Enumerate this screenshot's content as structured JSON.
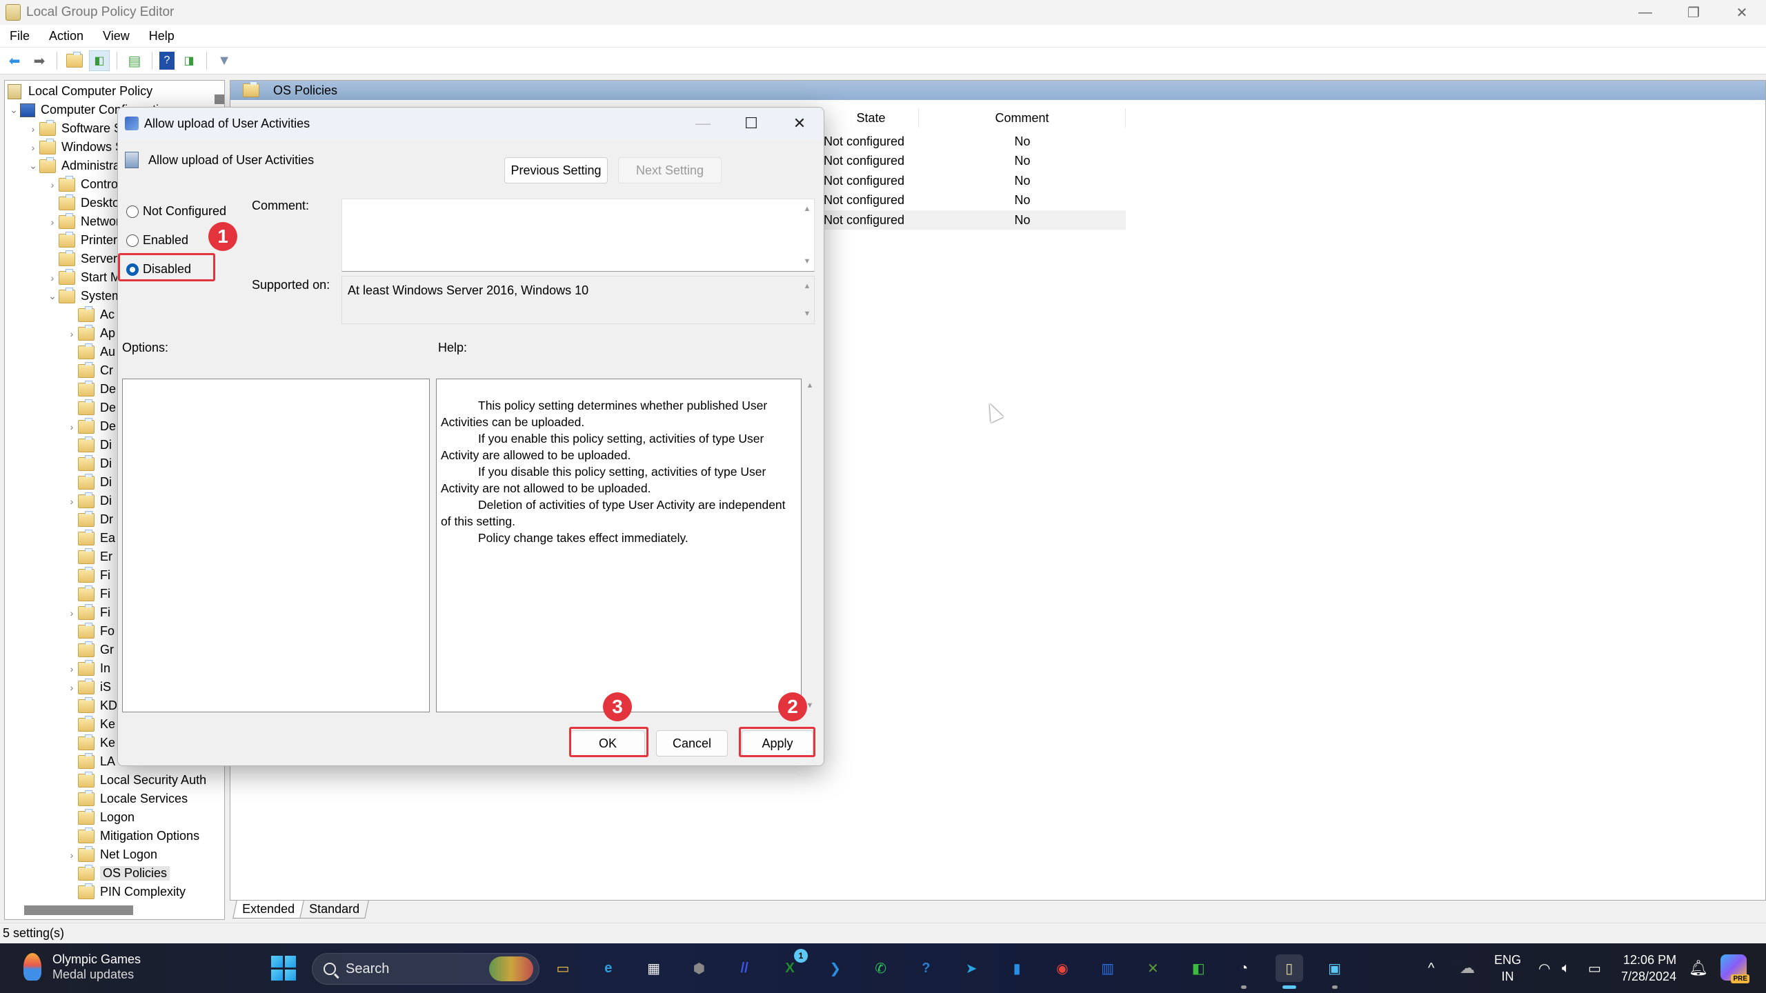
{
  "window": {
    "title": "Local Group Policy Editor",
    "controls": {
      "minimize": "—",
      "restore": "❐",
      "close": "✕"
    }
  },
  "menu": [
    "File",
    "Action",
    "View",
    "Help"
  ],
  "toolbar": {
    "icons": [
      "back-icon",
      "forward-icon",
      "up-folder-icon",
      "show-hide-tree-icon",
      "export-list-icon",
      "help-icon",
      "show-hide-action-pane-icon",
      "filter-icon"
    ]
  },
  "tree": {
    "root": "Local Computer Policy",
    "computer_config": "Computer Configuration",
    "items": [
      {
        "label": "Software Settings",
        "level": 2,
        "chevron": "›"
      },
      {
        "label": "Windows Settings",
        "level": 2,
        "chevron": "›"
      },
      {
        "label": "Administrative Templates",
        "level": 2,
        "chevron": "⌄"
      },
      {
        "label": "Control Panel",
        "level": 3,
        "chevron": "›"
      },
      {
        "label": "Desktop",
        "level": 3,
        "chevron": ""
      },
      {
        "label": "Network",
        "level": 3,
        "chevron": "›"
      },
      {
        "label": "Printers",
        "level": 3,
        "chevron": ""
      },
      {
        "label": "Server",
        "level": 3,
        "chevron": ""
      },
      {
        "label": "Start Menu and Taskbar",
        "level": 3,
        "chevron": "›"
      },
      {
        "label": "System",
        "level": 3,
        "chevron": "⌄"
      },
      {
        "label": "Ac",
        "level": 4,
        "chevron": ""
      },
      {
        "label": "Ap",
        "level": 4,
        "chevron": "›"
      },
      {
        "label": "Au",
        "level": 4,
        "chevron": ""
      },
      {
        "label": "Cr",
        "level": 4,
        "chevron": ""
      },
      {
        "label": "De",
        "level": 4,
        "chevron": ""
      },
      {
        "label": "De",
        "level": 4,
        "chevron": ""
      },
      {
        "label": "De",
        "level": 4,
        "chevron": "›"
      },
      {
        "label": "Di",
        "level": 4,
        "chevron": ""
      },
      {
        "label": "Di",
        "level": 4,
        "chevron": ""
      },
      {
        "label": "Di",
        "level": 4,
        "chevron": ""
      },
      {
        "label": "Di",
        "level": 4,
        "chevron": "›"
      },
      {
        "label": "Dr",
        "level": 4,
        "chevron": ""
      },
      {
        "label": "Ea",
        "level": 4,
        "chevron": ""
      },
      {
        "label": "Er",
        "level": 4,
        "chevron": ""
      },
      {
        "label": "Fi",
        "level": 4,
        "chevron": ""
      },
      {
        "label": "Fi",
        "level": 4,
        "chevron": ""
      },
      {
        "label": "Fi",
        "level": 4,
        "chevron": "›"
      },
      {
        "label": "Fo",
        "level": 4,
        "chevron": ""
      },
      {
        "label": "Gr",
        "level": 4,
        "chevron": ""
      },
      {
        "label": "In",
        "level": 4,
        "chevron": "›"
      },
      {
        "label": "iS",
        "level": 4,
        "chevron": "›"
      },
      {
        "label": "KD",
        "level": 4,
        "chevron": ""
      },
      {
        "label": "Ke",
        "level": 4,
        "chevron": ""
      },
      {
        "label": "Ke",
        "level": 4,
        "chevron": ""
      },
      {
        "label": "LA",
        "level": 4,
        "chevron": ""
      },
      {
        "label": "Local Security Auth",
        "level": 4,
        "chevron": ""
      },
      {
        "label": "Locale Services",
        "level": 4,
        "chevron": ""
      },
      {
        "label": "Logon",
        "level": 4,
        "chevron": ""
      },
      {
        "label": "Mitigation Options",
        "level": 4,
        "chevron": ""
      },
      {
        "label": "Net Logon",
        "level": 4,
        "chevron": "›"
      },
      {
        "label": "OS Policies",
        "level": 4,
        "chevron": "",
        "selected": true
      },
      {
        "label": "PIN Complexity",
        "level": 4,
        "chevron": ""
      }
    ]
  },
  "right_pane": {
    "folder": "OS Policies",
    "columns": {
      "state": "State",
      "comment": "Comment"
    },
    "rows": [
      {
        "state": "Not configured",
        "comment": "No"
      },
      {
        "state": "Not configured",
        "comment": "No"
      },
      {
        "state": "Not configured",
        "comment": "No"
      },
      {
        "state": "Not configured",
        "comment": "No"
      },
      {
        "state": "Not configured",
        "comment": "No"
      }
    ],
    "tabs": [
      "Extended",
      "Standard"
    ]
  },
  "status": "5 setting(s)",
  "dialog": {
    "title": "Allow upload of User Activities",
    "setting_name": "Allow upload of User Activities",
    "prev_button": "Previous Setting",
    "next_button": "Next Setting",
    "radios": [
      {
        "label": "Not Configured",
        "checked": false
      },
      {
        "label": "Enabled",
        "checked": false
      },
      {
        "label": "Disabled",
        "checked": true
      }
    ],
    "comment_label": "Comment:",
    "comment_value": "",
    "supported_label": "Supported on:",
    "supported_value": "At least Windows Server 2016, Windows 10",
    "options_label": "Options:",
    "help_label": "Help:",
    "help_paragraphs": [
      "This policy setting determines whether published User Activities can be uploaded.",
      "If you enable this policy setting, activities of type User Activity are allowed to be uploaded.",
      "If you disable this policy setting, activities of type User Activity are not allowed to be uploaded.",
      "Deletion of activities of type User Activity are independent of this setting.",
      "Policy change takes effect immediately."
    ],
    "ok": "OK",
    "cancel": "Cancel",
    "apply": "Apply"
  },
  "annotations": {
    "color": "#e3343d",
    "badges": [
      "1",
      "2",
      "3"
    ]
  },
  "taskbar": {
    "widget_title": "Olympic Games",
    "widget_sub": "Medal updates",
    "search_placeholder": "Search",
    "apps": [
      {
        "name": "file-explorer-icon",
        "glyph": "▭",
        "color": "#f5c542"
      },
      {
        "name": "edge-icon",
        "glyph": "e",
        "color": "#2ea0e0"
      },
      {
        "name": "ms-store-icon",
        "glyph": "▦",
        "color": "#f0f0f0"
      },
      {
        "name": "app-hex-icon",
        "glyph": "⬢",
        "color": "#888"
      },
      {
        "name": "app-blue-icon",
        "glyph": "//",
        "color": "#3d56e8"
      },
      {
        "name": "xbox-icon",
        "glyph": "X",
        "color": "#1f8f2a",
        "badge": "1"
      },
      {
        "name": "vscode-icon",
        "glyph": "❯",
        "color": "#2a8fe0"
      },
      {
        "name": "whatsapp-icon",
        "glyph": "✆",
        "color": "#2ecc55"
      },
      {
        "name": "help-chat-icon",
        "glyph": "?",
        "color": "#2a7fd0"
      },
      {
        "name": "telegram-icon",
        "glyph": "➤",
        "color": "#2aa3e0"
      },
      {
        "name": "app-box-icon",
        "glyph": "▮",
        "color": "#2a8fe0"
      },
      {
        "name": "chrome-icon",
        "glyph": "◉",
        "color": "#e8463b"
      },
      {
        "name": "app-chart-icon",
        "glyph": "▥",
        "color": "#2a6fe0"
      },
      {
        "name": "app-xbox-green-icon",
        "glyph": "✕",
        "color": "#5a9a3a"
      },
      {
        "name": "app-green-icon",
        "glyph": "◧",
        "color": "#3cbc3c"
      },
      {
        "name": "clock-app-icon",
        "glyph": "◔",
        "color": "#ffffff"
      },
      {
        "name": "gpedit-icon",
        "glyph": "▯",
        "color": "#e8d8a0",
        "active": true
      },
      {
        "name": "app-window-icon",
        "glyph": "▣",
        "color": "#5cc8f5"
      }
    ],
    "lang_top": "ENG",
    "lang_bottom": "IN",
    "time": "12:06 PM",
    "date": "7/28/2024",
    "copilot_badge": "PRE"
  }
}
